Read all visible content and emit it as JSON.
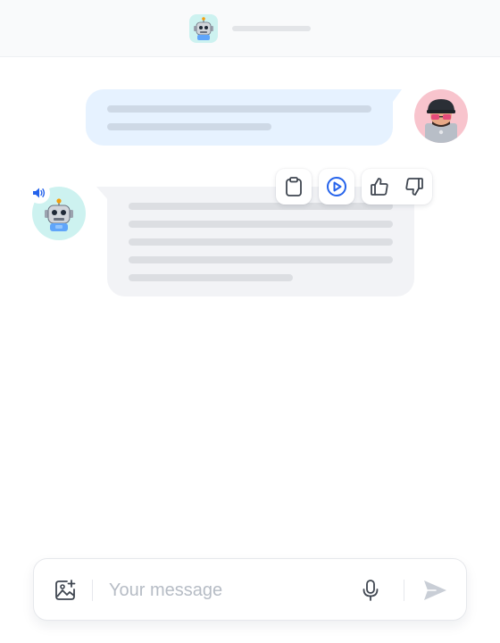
{
  "header": {
    "bot_avatar_icon": "robot-icon"
  },
  "conversation": {
    "user_message": {
      "avatar_icon": "user-avatar-sunglasses-cap",
      "bubble_color": "#e6f2ff",
      "placeholder_lines": 2
    },
    "bot_message": {
      "avatar_icon": "robot-icon",
      "status_icon": "speaker-playing-icon",
      "bubble_color": "#f2f3f6",
      "placeholder_lines": 5,
      "actions": [
        {
          "name": "copy",
          "icon": "clipboard-icon"
        },
        {
          "name": "play",
          "icon": "play-circle-icon",
          "color": "#2563eb"
        },
        {
          "name": "like",
          "icon": "thumbs-up-icon"
        },
        {
          "name": "dislike",
          "icon": "thumbs-down-icon"
        }
      ]
    }
  },
  "composer": {
    "placeholder": "Your message",
    "value": "",
    "attach_icon": "image-plus-icon",
    "mic_icon": "microphone-icon",
    "send_icon": "send-icon"
  },
  "colors": {
    "accent": "#2563eb",
    "icon_gray": "#3f4650",
    "placeholder_gray": "#b6bcc5"
  }
}
